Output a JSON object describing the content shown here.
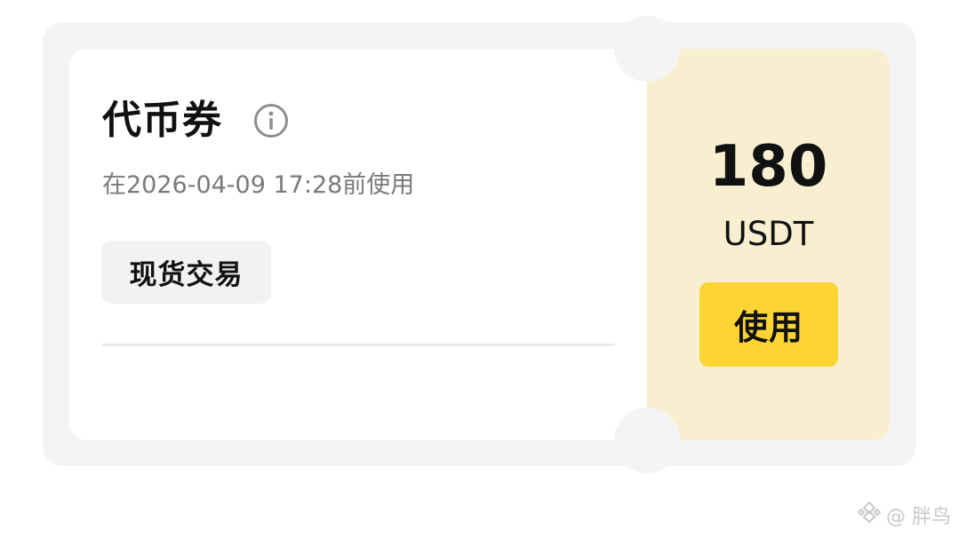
{
  "coupon": {
    "title": "代币券",
    "expiry": "在2026-04-09 17:28前使用",
    "tag": "现货交易",
    "amount": "180",
    "currency": "USDT",
    "use_label": "使用"
  },
  "watermark": {
    "text": "@ 胖鸟",
    "icon": "binance-logo-icon"
  },
  "colors": {
    "frame": "#f4f4f4",
    "card": "#ffffff",
    "amount_panel": "#f8eed0",
    "button": "#fcd535",
    "muted_text": "#7a7a7a",
    "text": "#111111"
  },
  "icons": {
    "info": "info-icon"
  }
}
